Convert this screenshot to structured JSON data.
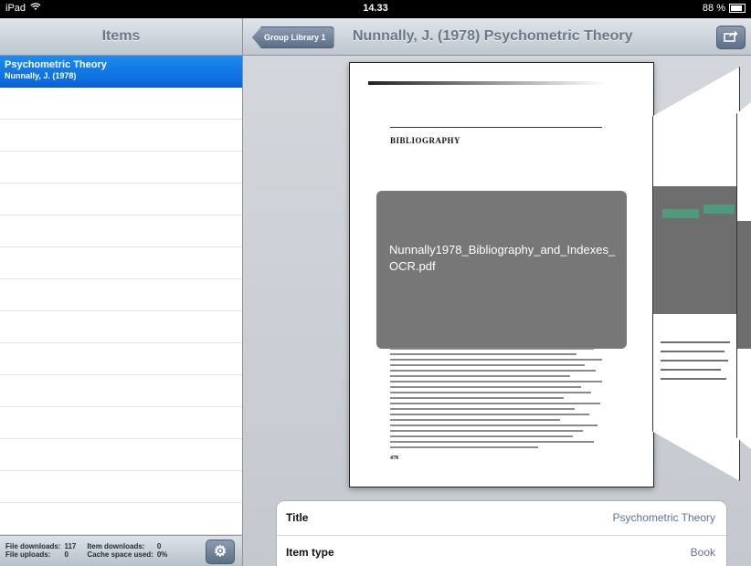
{
  "status_bar": {
    "device": "iPad",
    "time": "14.33",
    "battery": "88 %"
  },
  "left_panel": {
    "title": "Items",
    "selected_item": {
      "title": "Psychometric Theory",
      "subtitle": "Nunnally, J. (1978)"
    },
    "footer": {
      "file_downloads_label": "File downloads:",
      "file_downloads_value": "117",
      "file_uploads_label": "File uploads:",
      "file_uploads_value": "0",
      "item_downloads_label": "Item downloads:",
      "item_downloads_value": "0",
      "cache_label": "Cache space used:",
      "cache_value": "0%"
    }
  },
  "right_panel": {
    "back_button": "Group Library 1",
    "title": "Nunnally, J. (1978) Psychometric Theory",
    "document": {
      "heading": "BIBLIOGRAPHY",
      "filename": "Nunnally1978_Bibliography_and_Indexes_OCR.pdf",
      "page_number": "478"
    },
    "fields": [
      {
        "label": "Title",
        "value": "Psychometric Theory"
      },
      {
        "label": "Item type",
        "value": "Book"
      }
    ]
  },
  "icons": [
    "wifi-icon",
    "battery-icon",
    "gear-icon",
    "share-icon"
  ]
}
